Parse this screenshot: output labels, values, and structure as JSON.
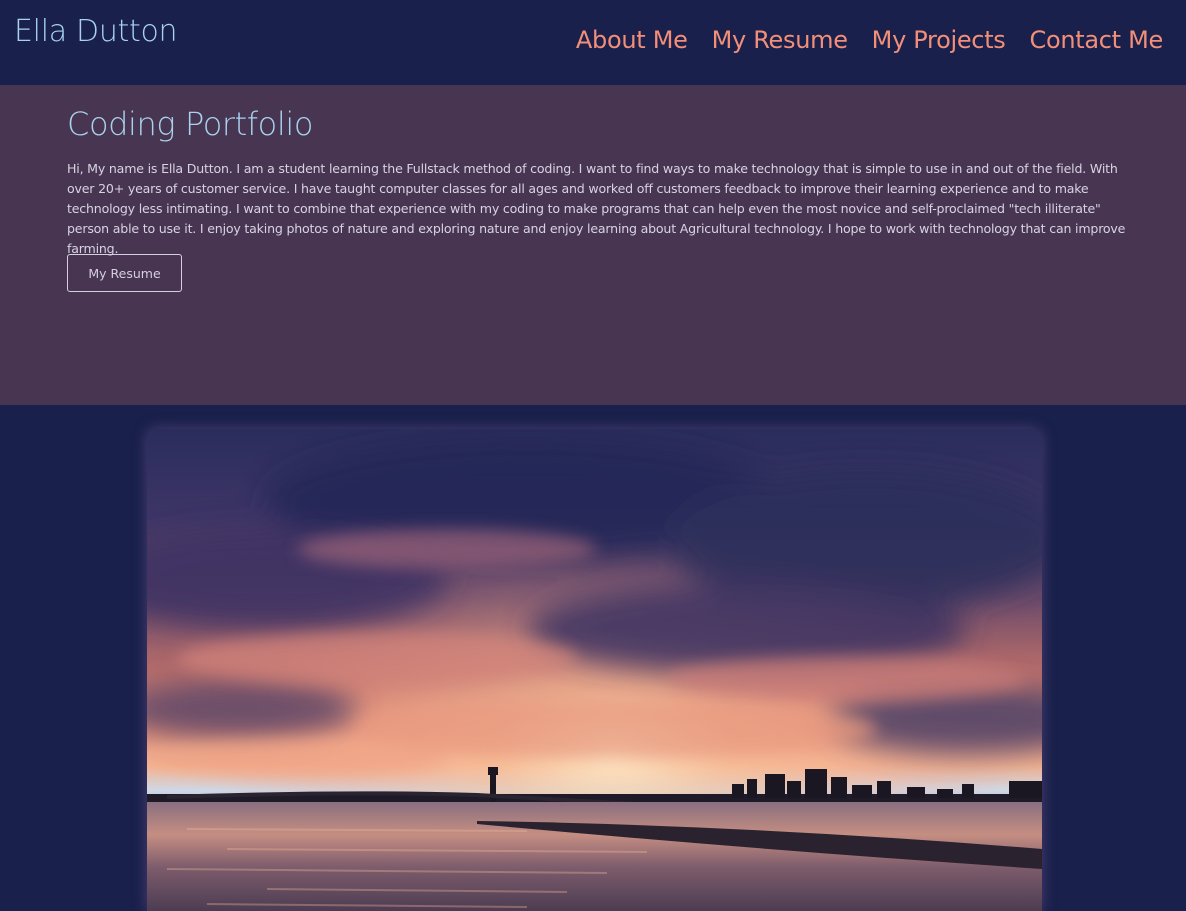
{
  "header": {
    "brand": "Ella Dutton",
    "nav": [
      {
        "label": "About Me"
      },
      {
        "label": "My Resume"
      },
      {
        "label": "My Projects"
      },
      {
        "label": "Contact Me"
      }
    ]
  },
  "hero": {
    "title": "Coding Portfolio",
    "description": "Hi, My name is Ella Dutton. I am a student learning the Fullstack method of coding. I want to find ways to make technology that is simple to use in and out of the field. With over 20+ years of customer service. I have taught computer classes for all ages and worked off customers feedback to improve their learning experience and to make technology less intimating. I want to combine that experience with my coding to make programs that can help even the most novice and self-proclaimed \"tech illiterate\" person able to use it. I enjoy taking photos of nature and exploring nature and enjoy learning about Agricultural technology. I hope to work with technology that can improve farming.",
    "button_label": "My Resume"
  },
  "photo": {
    "subject": "sunset-over-bay-photo"
  },
  "colors": {
    "background": "#19204b",
    "hero_background": "#483552",
    "brand_text": "#a9d2ec",
    "nav_link": "#f38f78",
    "body_text": "#d8d3e2"
  }
}
